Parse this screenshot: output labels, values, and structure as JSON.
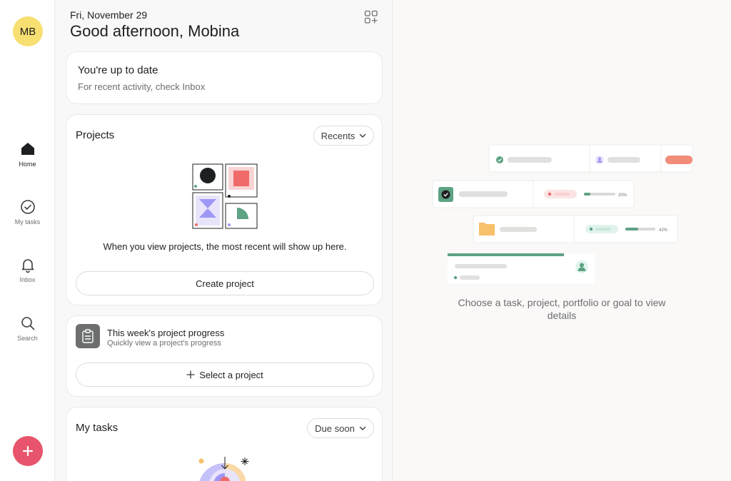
{
  "sidebar": {
    "avatar_initials": "MB",
    "avatar_color": "#f8df72",
    "items": [
      {
        "label": "Home",
        "icon": "home-icon",
        "active": true
      },
      {
        "label": "My tasks",
        "icon": "check-circle-icon",
        "active": false
      },
      {
        "label": "Inbox",
        "icon": "bell-icon",
        "active": false
      },
      {
        "label": "Search",
        "icon": "search-icon",
        "active": false
      }
    ],
    "fab_icon": "plus-icon",
    "fab_color": "#e8546b"
  },
  "header": {
    "date": "Fri, November 29",
    "greeting": "Good afternoon, Mobina",
    "customize_icon": "widgets-add-icon"
  },
  "inbox_card": {
    "title": "You're up to date",
    "subtitle": "For recent activity, check Inbox"
  },
  "projects_card": {
    "title": "Projects",
    "filter": "Recents",
    "empty_message": "When you view projects, the most recent will show up here.",
    "create_label": "Create project"
  },
  "progress_card": {
    "title": "This week's project progress",
    "subtitle": "Quickly view a project's progress",
    "select_label": "Select a project"
  },
  "tasks_card": {
    "title": "My tasks",
    "filter": "Due soon"
  },
  "details_panel": {
    "caption": "Choose a task, project, portfolio or goal to view details",
    "row_2_percent": "20%",
    "row_3_percent": "42%",
    "accent_colors": {
      "green": "#5da283",
      "salmon": "#f06a6a",
      "folder": "#f8c06a",
      "purple": "#9e97f7"
    }
  }
}
